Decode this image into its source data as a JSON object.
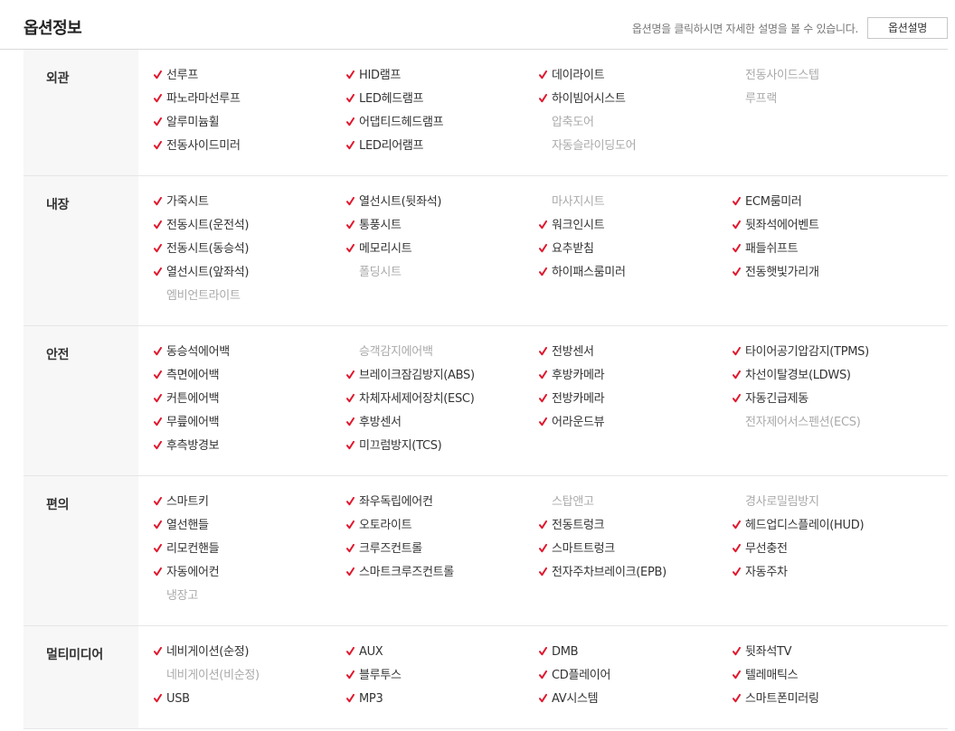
{
  "header": {
    "title": "옵션정보",
    "hint": "옵션명을 클릭하시면 자세한 설명을 볼 수 있습니다.",
    "button_label": "옵션설명"
  },
  "colors": {
    "check": "#e0182d",
    "available": "#333333",
    "unavailable": "#aaaaaa"
  },
  "categories": [
    {
      "label": "외관",
      "columns": [
        [
          {
            "label": "선루프",
            "on": true
          },
          {
            "label": "파노라마선루프",
            "on": true
          },
          {
            "label": "알루미늄휠",
            "on": true
          },
          {
            "label": "전동사이드미러",
            "on": true
          }
        ],
        [
          {
            "label": "HID램프",
            "on": true
          },
          {
            "label": "LED헤드램프",
            "on": true
          },
          {
            "label": "어댑티드헤드램프",
            "on": true
          },
          {
            "label": "LED리어램프",
            "on": true
          }
        ],
        [
          {
            "label": "데이라이트",
            "on": true
          },
          {
            "label": "하이빔어시스트",
            "on": true
          },
          {
            "label": "압축도어",
            "on": false
          },
          {
            "label": "자동슬라이딩도어",
            "on": false
          }
        ],
        [
          {
            "label": "전동사이드스텝",
            "on": false
          },
          {
            "label": "루프랙",
            "on": false
          }
        ]
      ]
    },
    {
      "label": "내장",
      "columns": [
        [
          {
            "label": "가죽시트",
            "on": true
          },
          {
            "label": "전동시트(운전석)",
            "on": true
          },
          {
            "label": "전동시트(동승석)",
            "on": true
          },
          {
            "label": "열선시트(앞좌석)",
            "on": true
          },
          {
            "label": "엠비언트라이트",
            "on": false
          }
        ],
        [
          {
            "label": "열선시트(뒷좌석)",
            "on": true
          },
          {
            "label": "통풍시트",
            "on": true
          },
          {
            "label": "메모리시트",
            "on": true
          },
          {
            "label": "폴딩시트",
            "on": false
          }
        ],
        [
          {
            "label": "마사지시트",
            "on": false
          },
          {
            "label": "워크인시트",
            "on": true
          },
          {
            "label": "요추받침",
            "on": true
          },
          {
            "label": "하이패스룸미러",
            "on": true
          }
        ],
        [
          {
            "label": "ECM룸미러",
            "on": true
          },
          {
            "label": "뒷좌석에어벤트",
            "on": true
          },
          {
            "label": "패들쉬프트",
            "on": true
          },
          {
            "label": "전동햇빛가리개",
            "on": true
          }
        ]
      ]
    },
    {
      "label": "안전",
      "columns": [
        [
          {
            "label": "동승석에어백",
            "on": true
          },
          {
            "label": "측면에어백",
            "on": true
          },
          {
            "label": "커튼에어백",
            "on": true
          },
          {
            "label": "무릎에어백",
            "on": true
          },
          {
            "label": "후측방경보",
            "on": true
          }
        ],
        [
          {
            "label": "승객감지에어백",
            "on": false
          },
          {
            "label": "브레이크잠김방지(ABS)",
            "on": true
          },
          {
            "label": "차체자세제어장치(ESC)",
            "on": true
          },
          {
            "label": "후방센서",
            "on": true
          },
          {
            "label": "미끄럼방지(TCS)",
            "on": true
          }
        ],
        [
          {
            "label": "전방센서",
            "on": true
          },
          {
            "label": "후방카메라",
            "on": true
          },
          {
            "label": "전방카메라",
            "on": true
          },
          {
            "label": "어라운드뷰",
            "on": true
          }
        ],
        [
          {
            "label": "타이어공기압감지(TPMS)",
            "on": true
          },
          {
            "label": "차선이탈경보(LDWS)",
            "on": true
          },
          {
            "label": "자동긴급제동",
            "on": true
          },
          {
            "label": "전자제어서스펜션(ECS)",
            "on": false
          }
        ]
      ]
    },
    {
      "label": "편의",
      "columns": [
        [
          {
            "label": "스마트키",
            "on": true
          },
          {
            "label": "열선핸들",
            "on": true
          },
          {
            "label": "리모컨핸들",
            "on": true
          },
          {
            "label": "자동에어컨",
            "on": true
          },
          {
            "label": "냉장고",
            "on": false
          }
        ],
        [
          {
            "label": "좌우독립에어컨",
            "on": true
          },
          {
            "label": "오토라이트",
            "on": true
          },
          {
            "label": "크루즈컨트롤",
            "on": true
          },
          {
            "label": "스마트크루즈컨트롤",
            "on": true
          }
        ],
        [
          {
            "label": "스탑앤고",
            "on": false
          },
          {
            "label": "전동트렁크",
            "on": true
          },
          {
            "label": "스마트트렁크",
            "on": true
          },
          {
            "label": "전자주차브레이크(EPB)",
            "on": true
          }
        ],
        [
          {
            "label": "경사로밀림방지",
            "on": false
          },
          {
            "label": "헤드업디스플레이(HUD)",
            "on": true
          },
          {
            "label": "무선충전",
            "on": true
          },
          {
            "label": "자동주차",
            "on": true
          }
        ]
      ]
    },
    {
      "label": "멀티미디어",
      "columns": [
        [
          {
            "label": "네비게이션(순정)",
            "on": true
          },
          {
            "label": "네비게이션(비순정)",
            "on": false
          },
          {
            "label": "USB",
            "on": true
          }
        ],
        [
          {
            "label": "AUX",
            "on": true
          },
          {
            "label": "블루투스",
            "on": true
          },
          {
            "label": "MP3",
            "on": true
          }
        ],
        [
          {
            "label": "DMB",
            "on": true
          },
          {
            "label": "CD플레이어",
            "on": true
          },
          {
            "label": "AV시스템",
            "on": true
          }
        ],
        [
          {
            "label": "뒷좌석TV",
            "on": true
          },
          {
            "label": "텔레매틱스",
            "on": true
          },
          {
            "label": "스마트폰미러링",
            "on": true
          }
        ]
      ]
    }
  ]
}
